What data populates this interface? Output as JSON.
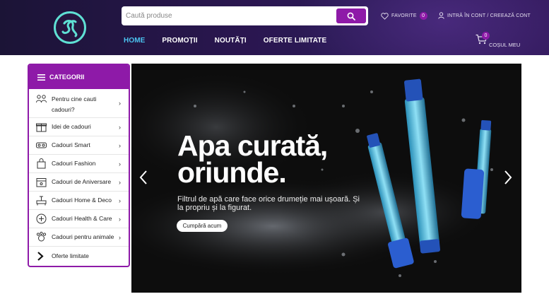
{
  "search": {
    "placeholder": "Caută produse"
  },
  "header": {
    "favorites_label": "FAVORITE",
    "favorites_count": "0",
    "account_label": "INTRĂ ÎN CONT / CREEAZĂ CONT",
    "cart_label": "COȘUL MEU",
    "cart_count": "0"
  },
  "nav": {
    "items": [
      {
        "label": "HOME"
      },
      {
        "label": "PROMOȚII"
      },
      {
        "label": "NOUTĂȚI"
      },
      {
        "label": "OFERTE LIMITATE"
      }
    ]
  },
  "categories": {
    "title": "CATEGORII",
    "items": [
      {
        "label": "Pentru cine cauti cadouri?"
      },
      {
        "label": "Idei de cadouri"
      },
      {
        "label": "Cadouri Smart"
      },
      {
        "label": "Cadouri Fashion"
      },
      {
        "label": "Cadouri de Aniversare"
      },
      {
        "label": "Cadouri Home & Deco"
      },
      {
        "label": "Cadouri Health & Care"
      },
      {
        "label": "Cadouri pentru animale"
      },
      {
        "label": "Oferte limitate"
      }
    ]
  },
  "hero": {
    "title": "Apa curată,\noriunde.",
    "subtitle": "Filtrul de apă care face orice drumeție mai ușoară. Și la propriu și la figurat.",
    "button": "Cumpără acum"
  },
  "colors": {
    "accent": "#8e1aa8",
    "nav_active": "#4bc3f0",
    "header_bg": "#261646"
  }
}
